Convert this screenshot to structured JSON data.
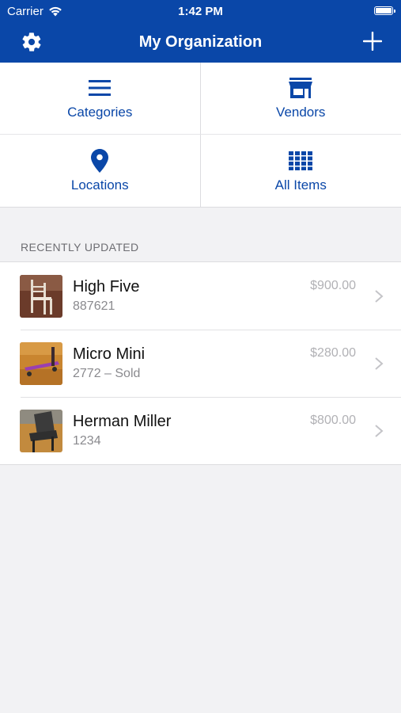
{
  "status_bar": {
    "carrier": "Carrier",
    "time": "1:42 PM"
  },
  "nav": {
    "title": "My Organization",
    "left_icon": "gear-icon",
    "right_icon": "plus-icon"
  },
  "tiles": [
    {
      "label": "Categories",
      "icon": "menu-icon"
    },
    {
      "label": "Vendors",
      "icon": "store-icon"
    },
    {
      "label": "Locations",
      "icon": "location-pin-icon"
    },
    {
      "label": "All Items",
      "icon": "grid-icon"
    }
  ],
  "recent": {
    "header": "RECENTLY UPDATED",
    "items": [
      {
        "name": "High Five",
        "sub": "887621",
        "price": "$900.00"
      },
      {
        "name": "Micro Mini",
        "sub": "2772 – Sold",
        "price": "$280.00"
      },
      {
        "name": "Herman Miller",
        "sub": "1234",
        "price": "$800.00"
      }
    ]
  },
  "colors": {
    "accent": "#0a47a8",
    "background": "#f2f2f4"
  }
}
